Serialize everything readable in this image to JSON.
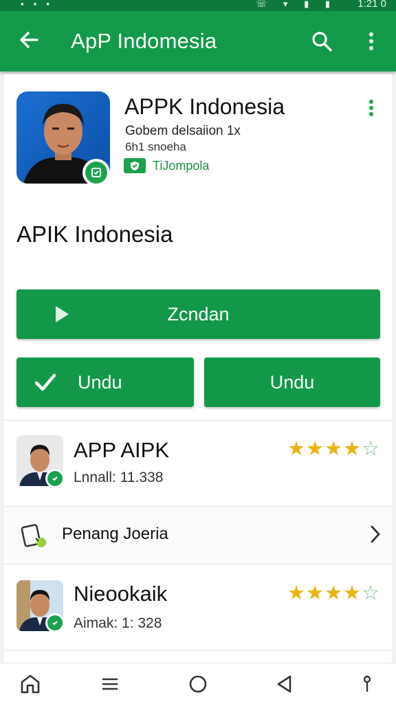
{
  "status_bar": {
    "time": "1:21 0",
    "left_icons": [
      "notification-icon",
      "image-icon",
      "shield-icon"
    ],
    "right_icons": [
      "phone-icon",
      "wifi-icon",
      "signal-icon",
      "battery-icon"
    ]
  },
  "app_bar": {
    "title": "ApP Indomesia",
    "back_icon": "back-arrow-icon",
    "search_icon": "search-icon",
    "more_icon": "more-vert-icon"
  },
  "app_header": {
    "name": "APPK Indonesia",
    "developer": "Gobem delsaiion 1x",
    "category": "6h1 snoeha",
    "verified_label": "TiJompola",
    "more_icon": "more-vert-icon"
  },
  "section_title": "APIK Indonesia",
  "buttons": {
    "primary_label": "Zcndan",
    "left_label": "Undu",
    "right_label": "Undu"
  },
  "list": [
    {
      "title": "APP AIPK",
      "subtitle": "Lnnall: 11.338",
      "rating": 4,
      "max_rating": 5
    },
    {
      "title": "Nieookaik",
      "subtitle": "Aimak: 1: 328",
      "rating": 4,
      "max_rating": 5
    }
  ],
  "link_row": {
    "label": "Penang Joeria",
    "icon": "phone-settings-icon",
    "chevron_icon": "chevron-right-icon"
  },
  "nav_bar": {
    "icons": [
      "home-icon",
      "menu-icon",
      "circle-home-icon",
      "back-triangle-icon",
      "accessibility-icon"
    ]
  },
  "colors": {
    "primary": "#129a4a",
    "status_bar": "#0d7a3c",
    "star": "#e8b410",
    "star_empty": "#7fbf8e"
  }
}
